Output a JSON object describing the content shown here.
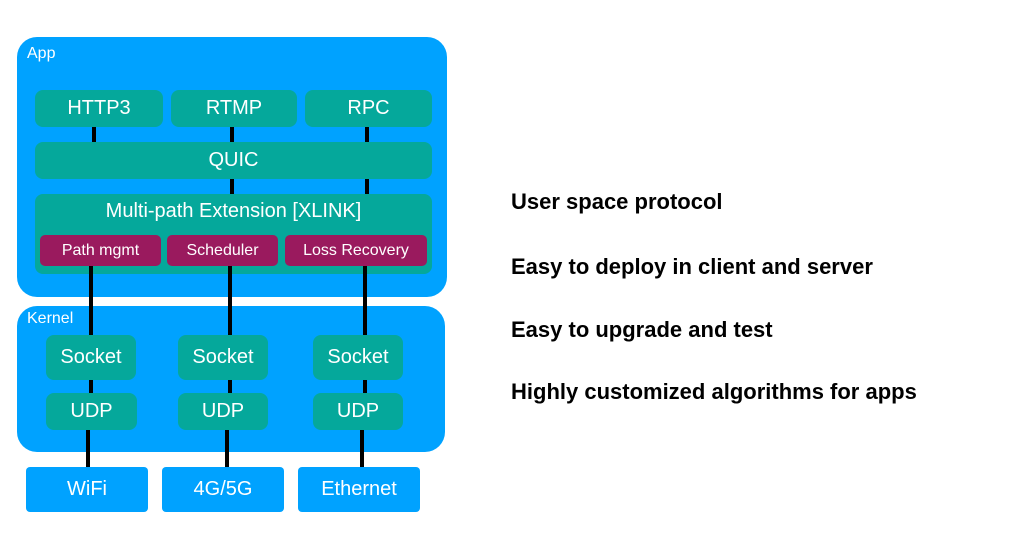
{
  "diagram": {
    "app_layer": {
      "label": "App",
      "protocols": [
        "HTTP3",
        "RTMP",
        "RPC"
      ],
      "transport": "QUIC",
      "extension": {
        "label": "Multi-path Extension [XLINK]",
        "modules": [
          "Path mgmt",
          "Scheduler",
          "Loss Recovery"
        ]
      }
    },
    "kernel_layer": {
      "label": "Kernel",
      "paths": [
        {
          "socket": "Socket",
          "udp": "UDP"
        },
        {
          "socket": "Socket",
          "udp": "UDP"
        },
        {
          "socket": "Socket",
          "udp": "UDP"
        }
      ]
    },
    "networks": [
      "WiFi",
      "4G/5G",
      "Ethernet"
    ],
    "colors": {
      "layer_blue": "#00a2ff",
      "component_teal": "#05a89b",
      "module_magenta": "#9a1a5e",
      "connector": "#000000"
    }
  },
  "features": [
    "User space protocol",
    "Easy to deploy in client and server",
    "Easy to upgrade and test",
    "Highly customized algorithms for apps"
  ]
}
